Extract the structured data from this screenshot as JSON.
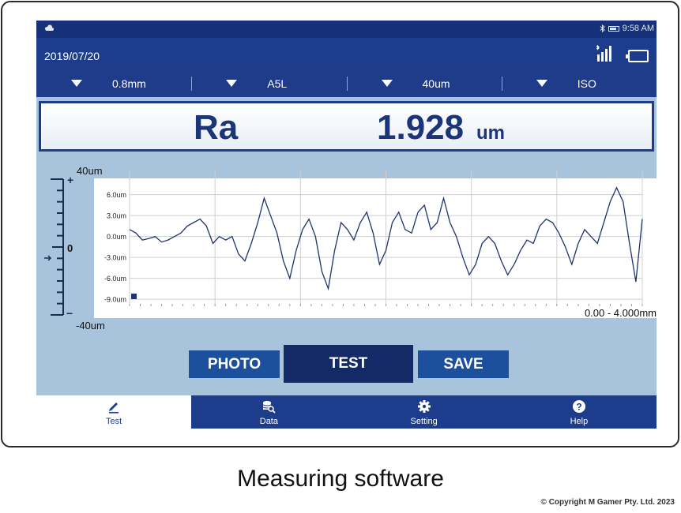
{
  "status_bar": {
    "bluetooth_icon": "bluetooth-icon",
    "time": "9:58 AM"
  },
  "header": {
    "date": "2019/07/20",
    "signal_icon": "signal-icon",
    "battery_icon": "battery-icon"
  },
  "params": [
    {
      "value": "0.8mm"
    },
    {
      "value": "A5L"
    },
    {
      "value": "40um"
    },
    {
      "value": "ISO"
    }
  ],
  "result": {
    "parameter": "Ra",
    "value": "1.928",
    "unit": "um"
  },
  "chart_data": {
    "type": "line",
    "y_ticks": [
      "6.0um",
      "3.0um",
      "0.0um",
      "-3.0um",
      "-6.0um",
      "-9.0um"
    ],
    "ylim": [
      -10,
      8
    ],
    "xlim": [
      0,
      4.0
    ],
    "grid": true,
    "series": [
      {
        "x": [
          0,
          0.05,
          0.1,
          0.15,
          0.2,
          0.25,
          0.3,
          0.35,
          0.4,
          0.45,
          0.5,
          0.55,
          0.6,
          0.65,
          0.7,
          0.75,
          0.8,
          0.85,
          0.9,
          0.95,
          1.0,
          1.05,
          1.1,
          1.15,
          1.2,
          1.25,
          1.3,
          1.35,
          1.4,
          1.45,
          1.5,
          1.55,
          1.6,
          1.65,
          1.7,
          1.75,
          1.8,
          1.85,
          1.9,
          1.95,
          2.0,
          2.05,
          2.1,
          2.15,
          2.2,
          2.25,
          2.3,
          2.35,
          2.4,
          2.45,
          2.5,
          2.55,
          2.6,
          2.65,
          2.7,
          2.75,
          2.8,
          2.85,
          2.9,
          2.95,
          3.0,
          3.05,
          3.1,
          3.15,
          3.2,
          3.25,
          3.3,
          3.35,
          3.4,
          3.45,
          3.5,
          3.55,
          3.6,
          3.65,
          3.7,
          3.75,
          3.8,
          3.85,
          3.9,
          3.95,
          4.0
        ],
        "y": [
          1,
          0.5,
          -0.5,
          -0.3,
          0,
          -0.8,
          -0.5,
          0,
          0.5,
          1.5,
          2,
          2.5,
          1.5,
          -1,
          0,
          -0.5,
          0,
          -2.5,
          -3.5,
          -1,
          2,
          5.5,
          3,
          0.5,
          -3.5,
          -6,
          -2,
          1,
          2.5,
          0,
          -5,
          -7.5,
          -2,
          2,
          1,
          -0.5,
          2,
          3.5,
          0.5,
          -4,
          -2,
          2,
          3.5,
          1,
          0.5,
          3.5,
          4.5,
          1,
          2,
          5.5,
          2,
          0,
          -3,
          -5.5,
          -4,
          -1,
          0,
          -1,
          -3.5,
          -5.5,
          -4,
          -2,
          -0.5,
          -1,
          1.5,
          2.5,
          2,
          0.5,
          -1.5,
          -4,
          -1,
          1,
          0,
          -1,
          2,
          5,
          7,
          5,
          -1,
          -6.5,
          2.5
        ]
      }
    ],
    "scale_top": "40um",
    "scale_zero": "0",
    "scale_bottom": "-40um",
    "range_label": "0.00 - 4.000mm"
  },
  "buttons": {
    "photo": "PHOTO",
    "test": "TEST",
    "save": "SAVE"
  },
  "tabs": [
    {
      "label": "Test",
      "icon": "pencil-icon",
      "active": true
    },
    {
      "label": "Data",
      "icon": "database-search-icon",
      "active": false
    },
    {
      "label": "Setting",
      "icon": "gear-icon",
      "active": false
    },
    {
      "label": "Help",
      "icon": "help-icon",
      "active": false
    }
  ],
  "caption": "Measuring software",
  "copyright": "© Copyright M Gamer Pty. Ltd. 2023"
}
